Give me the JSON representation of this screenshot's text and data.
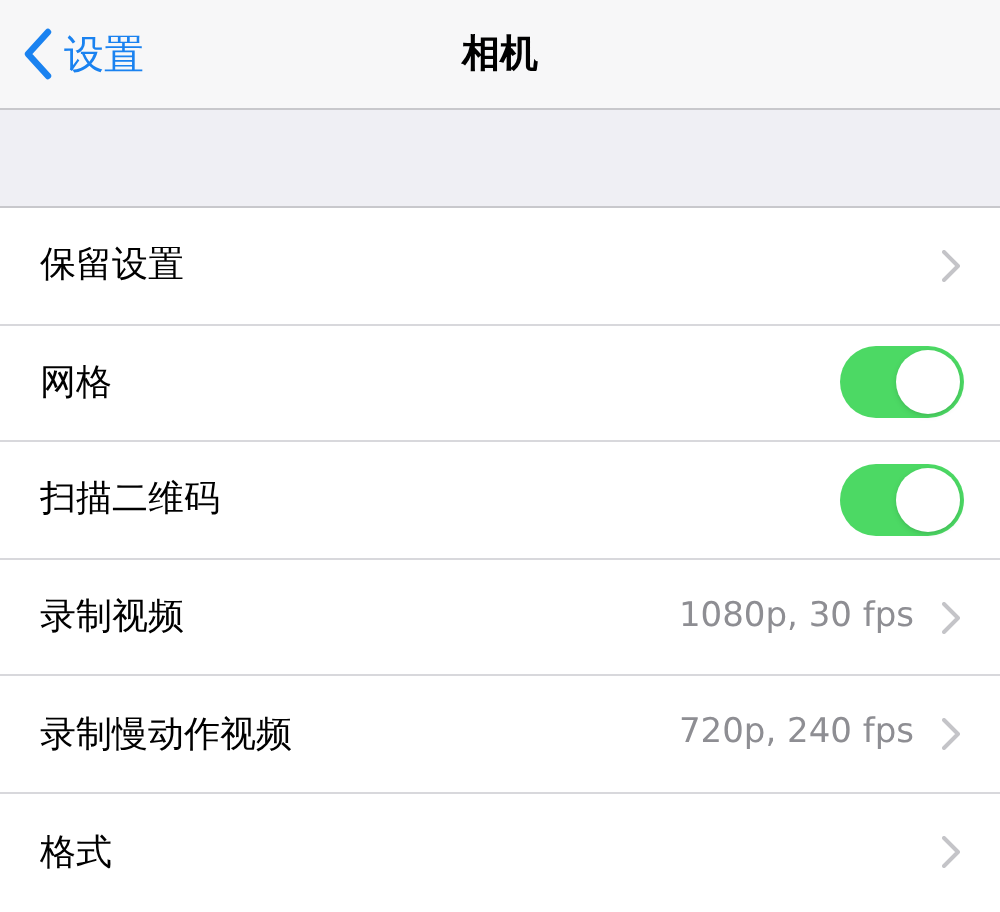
{
  "nav": {
    "back": "设置",
    "title": "相机"
  },
  "rows": [
    {
      "kind": "link",
      "label": "保留设置"
    },
    {
      "kind": "toggle",
      "label": "网格",
      "on": true
    },
    {
      "kind": "toggle",
      "label": "扫描二维码",
      "on": true
    },
    {
      "kind": "link",
      "label": "录制视频",
      "value": "1080p, 30 fps"
    },
    {
      "kind": "link",
      "label": "录制慢动作视频",
      "value": "720p, 240 fps"
    },
    {
      "kind": "link",
      "label": "格式"
    }
  ]
}
